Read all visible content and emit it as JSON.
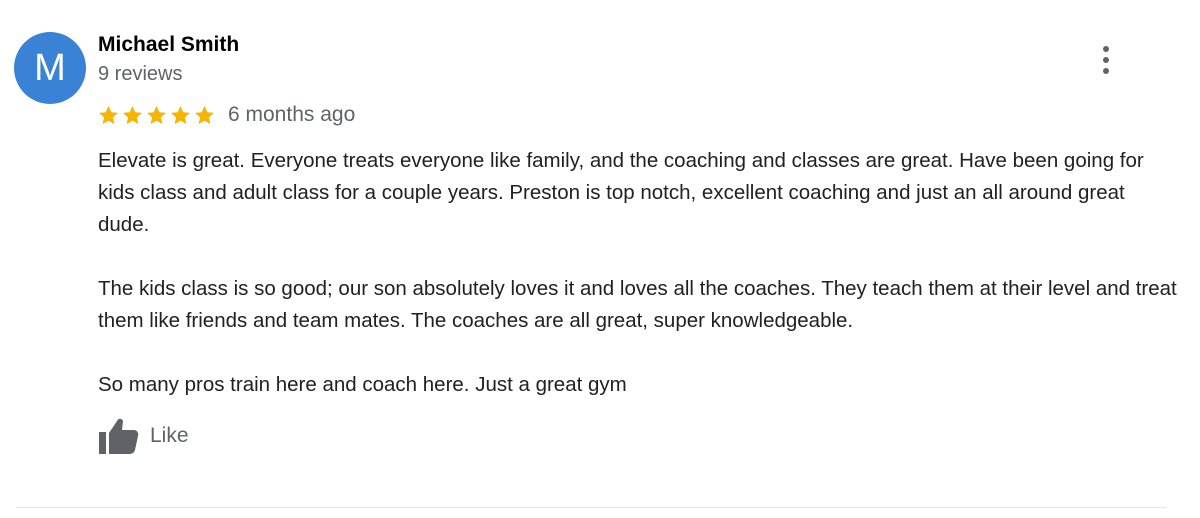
{
  "review": {
    "avatar_letter": "M",
    "reviewer_name": "Michael Smith",
    "reviewer_reviews": "9 reviews",
    "rating": 5,
    "rating_max": 5,
    "time": "6 months ago",
    "paragraphs": [
      "Elevate is great. Everyone treats everyone like family, and the coaching and classes are great. Have been going for kids class and adult class for a couple years. Preston is top notch, excellent coaching and just an all around great dude.",
      "The kids class is so good; our son absolutely loves it and loves all the coaches. They teach them at their level and treat them like friends and team mates. The coaches are all great, super knowledgeable.",
      "So many pros train here and coach here. Just a great gym"
    ],
    "like_label": "Like"
  },
  "icons": {
    "star": "star-icon",
    "more": "more-vertical-icon",
    "like": "thumbs-up-icon"
  },
  "colors": {
    "avatar_bg": "#3a82d6",
    "star": "#f4b400",
    "muted_text": "#5f6368",
    "icon": "#5f6368"
  }
}
